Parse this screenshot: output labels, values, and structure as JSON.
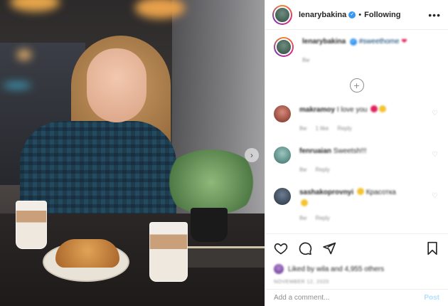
{
  "header": {
    "username": "lenarybakina",
    "separator": "•",
    "follow_state": "Following",
    "more_icon": "more-horizontal-icon"
  },
  "caption": {
    "username": "lenarybakina",
    "text": "#sweethome",
    "meta": "8w"
  },
  "load_more_icon": "plus-circle-icon",
  "comments": [
    {
      "username": "makramoy",
      "text": "I love you",
      "meta_time": "8w",
      "meta_likes": "1 like",
      "reply": "Reply"
    },
    {
      "username": "fenruaian",
      "text": "Sweetsh!!!",
      "meta_time": "8w",
      "reply": "Reply"
    },
    {
      "username": "sashakoprovnyi",
      "text": "Красотка",
      "meta_time": "8w",
      "reply": "Reply"
    }
  ],
  "actions": {
    "icons": [
      "heart-icon",
      "comment-icon",
      "share-icon",
      "bookmark-icon"
    ],
    "liked_by": "Liked by wila and 4,955 others",
    "date": "NOVEMBER 12, 2020"
  },
  "add_comment": {
    "placeholder": "Add a comment...",
    "post_label": "Post"
  },
  "colors": {
    "link_blue": "#3897f0",
    "muted_text": "#8e8e8e",
    "post_disabled": "#b2dffc",
    "verified_badge": "#3897f0"
  }
}
